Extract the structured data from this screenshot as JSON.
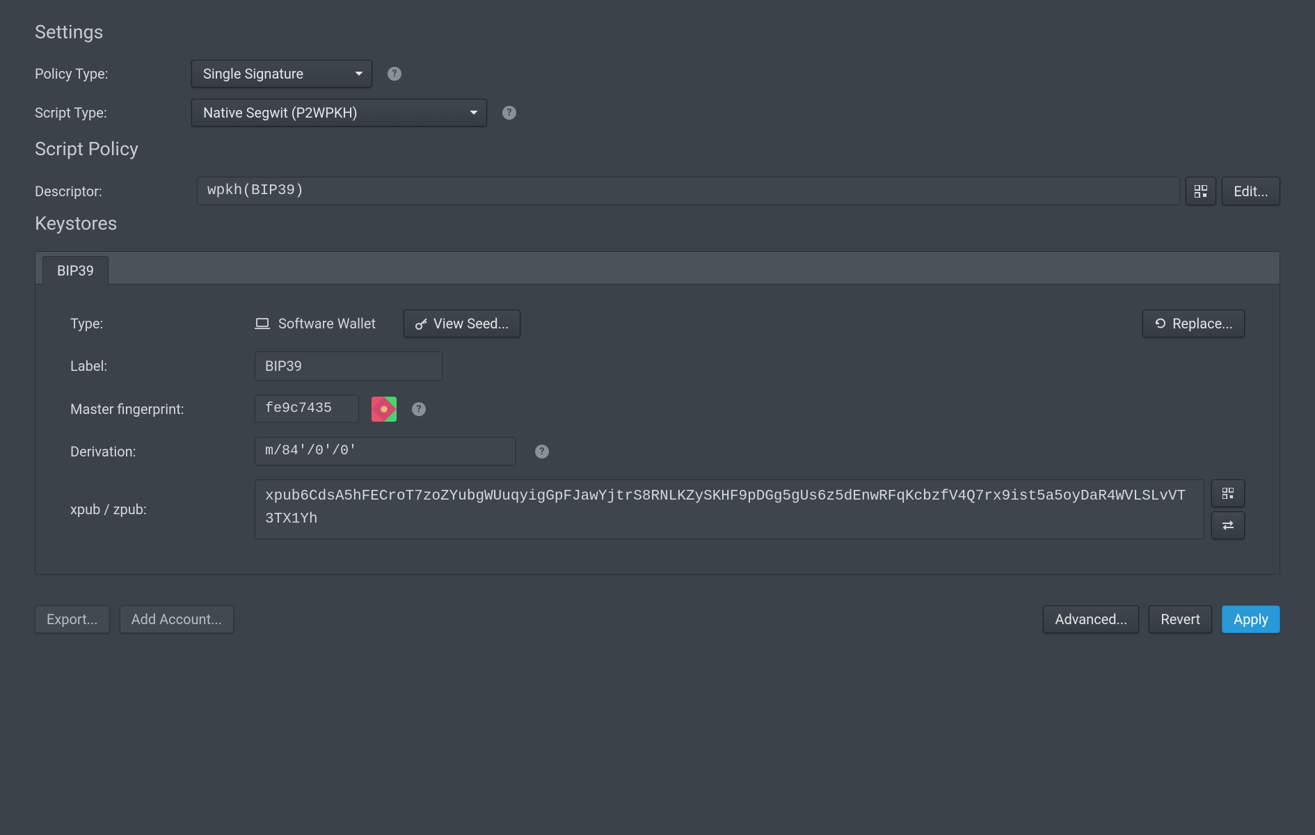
{
  "sections": {
    "settings_title": "Settings",
    "script_policy_title": "Script Policy",
    "keystores_title": "Keystores"
  },
  "settings": {
    "policy_type_label": "Policy Type:",
    "policy_type_value": "Single Signature",
    "script_type_label": "Script Type:",
    "script_type_value": "Native Segwit (P2WPKH)"
  },
  "script_policy": {
    "descriptor_label": "Descriptor:",
    "descriptor_value": "wpkh(BIP39)",
    "edit_label": "Edit..."
  },
  "keystores": {
    "tab_label": "BIP39",
    "type_label": "Type:",
    "type_value": "Software Wallet",
    "view_seed_label": "View Seed...",
    "replace_label": "Replace...",
    "label_label": "Label:",
    "label_value": "BIP39",
    "fingerprint_label": "Master fingerprint:",
    "fingerprint_value": "fe9c7435",
    "derivation_label": "Derivation:",
    "derivation_value": "m/84'/0'/0'",
    "xpub_label": "xpub / zpub:",
    "xpub_value": "xpub6CdsA5hFECroT7zoZYubgWUuqyigGpFJawYjtrS8RNLKZySKHF9pDGg5gUs6z5dEnwRFqKcbzfV4Q7rx9ist5a5oyDaR4WVLSLvVT3TX1Yh"
  },
  "footer": {
    "export_label": "Export...",
    "add_account_label": "Add Account...",
    "advanced_label": "Advanced...",
    "revert_label": "Revert",
    "apply_label": "Apply"
  }
}
